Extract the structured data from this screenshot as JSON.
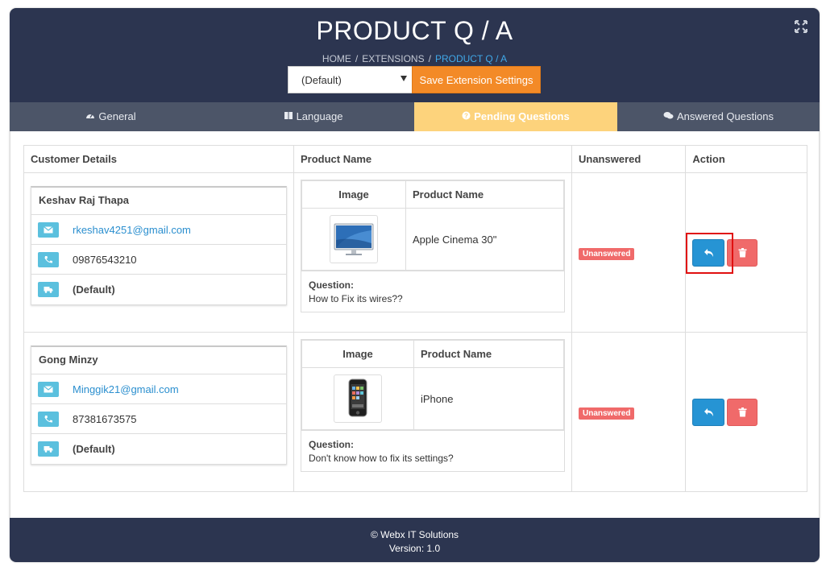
{
  "header": {
    "title": "PRODUCT Q / A",
    "breadcrumb": [
      "HOME",
      "EXTENSIONS",
      "PRODUCT Q / A"
    ],
    "store_select_value": "(Default)",
    "save_label": "Save Extension Settings"
  },
  "tabs": [
    {
      "label": "General",
      "icon": "dashboard-icon"
    },
    {
      "label": "Language",
      "icon": "book-icon"
    },
    {
      "label": "Pending Questions",
      "icon": "question-icon"
    },
    {
      "label": "Answered Questions",
      "icon": "comments-icon"
    }
  ],
  "table": {
    "headers": [
      "Customer Details",
      "Product Name",
      "Unanswered",
      "Action"
    ],
    "product_headers": [
      "Image",
      "Product Name"
    ],
    "question_label": "Question:",
    "rows": [
      {
        "customer": {
          "name": "Keshav Raj Thapa",
          "email": "rkeshav4251@gmail.com",
          "phone": "09876543210",
          "store": "(Default)"
        },
        "product": "Apple Cinema 30\"",
        "image": "apple-cinema-display",
        "question": "How to Fix its wires??",
        "status": "Unanswered"
      },
      {
        "customer": {
          "name": "Gong Minzy",
          "email": "Minggik21@gmail.com",
          "phone": "87381673575",
          "store": "(Default)"
        },
        "product": "iPhone",
        "image": "iphone",
        "question": "Don't know how to fix its settings?",
        "status": "Unanswered"
      }
    ]
  },
  "footer": {
    "line1": "© Webx IT Solutions",
    "line2": "Version: 1.0"
  },
  "colors": {
    "header_bg": "#2c3550",
    "tab_bar_bg": "#4c5568",
    "active_tab": "#fdd37c",
    "save_button": "#f38a27",
    "reply_button": "#2694d4",
    "delete_button": "#f06a6a",
    "info_icon_bg": "#5bc0de",
    "highlight": "#e01010"
  }
}
